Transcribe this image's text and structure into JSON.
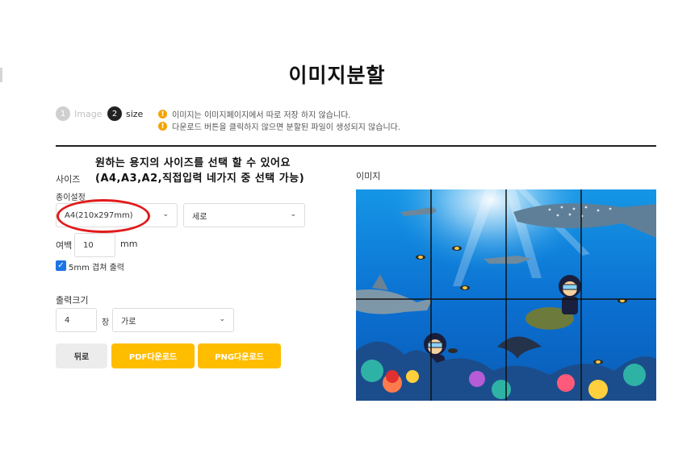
{
  "page_title": "이미지분할",
  "steps": [
    {
      "number": "1",
      "label": "Image"
    },
    {
      "number": "2",
      "label": "size"
    }
  ],
  "notices": [
    "이미지는 이미지페이지에서 따로 저장 하지 않습니다.",
    "다운로드 버튼을 클릭하지 않으면 분할된 파일이 생성되지 않습니다."
  ],
  "annotation": {
    "line1": "원하는 용지의 사이즈를 선택 할 수 있어요",
    "line2": "(A4,A3,A2,직접입력 네가지 중 선택 가능)"
  },
  "size_section": {
    "heading": "사이즈",
    "paper_label": "종이설정",
    "paper_value": "A4(210x297mm)",
    "orientation_value": "세로",
    "margin_label": "여백",
    "margin_value": "10",
    "margin_unit": "mm",
    "overlap_label": "5mm 겹쳐 출력",
    "overlap_checked": true
  },
  "output_section": {
    "heading": "출력크기",
    "count_value": "4",
    "count_unit": "장",
    "direction_value": "가로"
  },
  "buttons": {
    "back": "뒤로",
    "pdf": "PDF다운로드",
    "png": "PNG다운로드"
  },
  "image_section": {
    "heading": "이미지"
  },
  "colors": {
    "accent": "#ffbd00",
    "annotation_circle": "#e21b1b",
    "checkbox": "#1d74e4",
    "warning": "#f5a300"
  }
}
